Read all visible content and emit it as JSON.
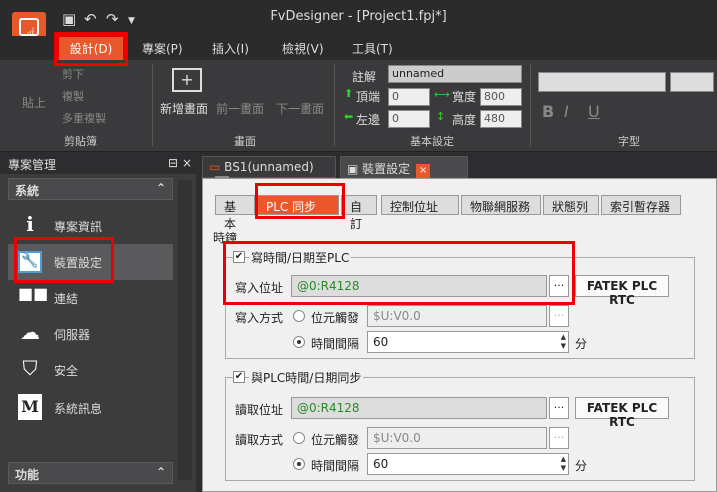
{
  "app": {
    "title": "FvDesigner - [Project1.fpj*]"
  },
  "qat": [
    "save-icon",
    "undo-icon",
    "redo-icon",
    "dropdown-icon"
  ],
  "menu": {
    "design": "設計(D)",
    "project": "專案(P)",
    "insert": "插入(I)",
    "view": "檢視(V)",
    "tools": "工具(T)"
  },
  "ribbon": {
    "clipboard": {
      "paste": "貼上",
      "cut": "剪下",
      "copy": "複製",
      "multi_copy": "多重複製",
      "title": "剪貼簿"
    },
    "screen": {
      "new": "新增畫面",
      "prev": "前一畫面",
      "next": "下一畫面",
      "title": "畫面"
    },
    "basic": {
      "comment_label": "註解",
      "comment_value": "unnamed",
      "top_label": "頂端",
      "top_value": "0",
      "left_label": "左邊",
      "left_value": "0",
      "width_label": "寬度",
      "width_value": "800",
      "height_label": "高度",
      "height_value": "480",
      "title": "基本設定"
    },
    "font": {
      "title": "字型"
    }
  },
  "left_panel": {
    "title": "專案管理",
    "system_section": "系統",
    "items": [
      "專案資訊",
      "裝置設定",
      "連結",
      "伺服器",
      "安全",
      "系統訊息"
    ],
    "function_section": "功能"
  },
  "doc_tabs": [
    "BS1(unnamed)",
    "裝置設定"
  ],
  "prop_tabs": [
    "基本",
    "PLC 同步",
    "自訂",
    "控制位址",
    "物聯網服務",
    "狀態列",
    "索引暫存器"
  ],
  "clock": {
    "section_label": "時鐘",
    "write": {
      "checkbox_label": "寫時間/日期至PLC",
      "addr_label": "寫入位址",
      "addr_value": "@0:R4128",
      "rtc_button": "FATEK PLC RTC",
      "mode_label": "寫入方式",
      "trigger_label": "位元觸發",
      "trigger_value": "$U:V0.0",
      "interval_label": "時間間隔",
      "interval_value": "60",
      "unit": "分"
    },
    "read": {
      "checkbox_label": "與PLC時間/日期同步",
      "addr_label": "讀取位址",
      "addr_value": "@0:R4128",
      "rtc_button": "FATEK PLC RTC",
      "mode_label": "讀取方式",
      "trigger_label": "位元觸發",
      "trigger_value": "$U:V0.0",
      "interval_label": "時間間隔",
      "interval_value": "60",
      "unit": "分"
    }
  },
  "colors": {
    "accent": "#e8582a",
    "highlight": "#e00000"
  }
}
